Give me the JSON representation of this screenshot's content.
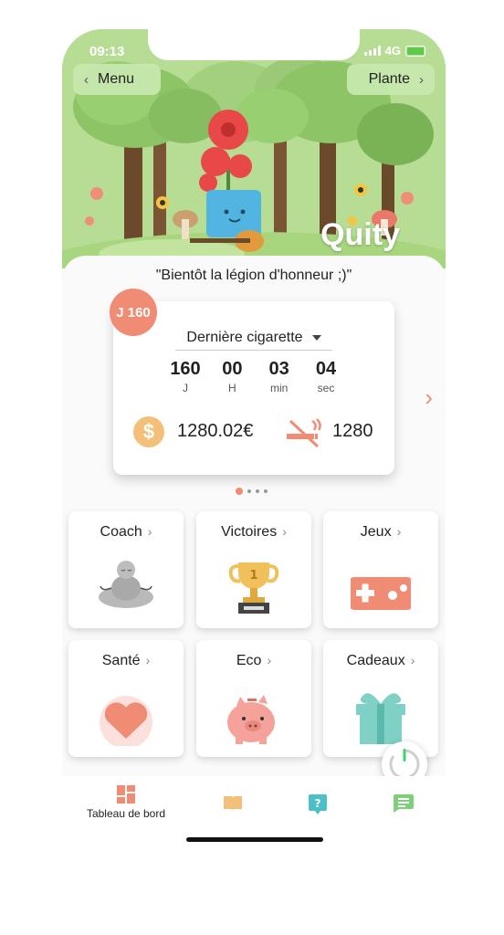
{
  "status": {
    "time": "09:13",
    "network": "4G"
  },
  "header": {
    "menu_label": "Menu",
    "plante_label": "Plante",
    "brand": "Quity"
  },
  "quote": "\"Bientôt la légion d'honneur ;)\"",
  "card": {
    "day_badge": "J 160",
    "dropdown_label": "Dernière cigarette",
    "timer": [
      {
        "value": "160",
        "unit": "J"
      },
      {
        "value": "00",
        "unit": "H"
      },
      {
        "value": "03",
        "unit": "min"
      },
      {
        "value": "04",
        "unit": "sec"
      }
    ],
    "money_symbol": "$",
    "money_saved": "1280.02€",
    "cigarettes_avoided": "1280"
  },
  "pager": {
    "pages": 4,
    "active": 1
  },
  "tiles": [
    {
      "label": "Coach",
      "icon": "meditation-icon"
    },
    {
      "label": "Victoires",
      "icon": "trophy-icon"
    },
    {
      "label": "Jeux",
      "icon": "gamepad-icon"
    },
    {
      "label": "Santé",
      "icon": "heart-icon"
    },
    {
      "label": "Eco",
      "icon": "piggy-bank-icon"
    },
    {
      "label": "Cadeaux",
      "icon": "gift-icon"
    }
  ],
  "tabbar": {
    "dashboard_label": "Tableau de bord",
    "tabs": [
      "dashboard-icon",
      "book-icon",
      "help-icon",
      "chat-icon"
    ]
  },
  "colors": {
    "accent": "#f08c74",
    "hero_green": "#b7dd95",
    "coin": "#f2c078"
  }
}
